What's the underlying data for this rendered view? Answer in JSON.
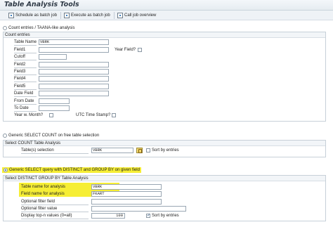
{
  "window": {
    "title": "Table Analysis Tools"
  },
  "toolbar": {
    "buttons": [
      {
        "label": "Schedule as batch job",
        "icon": "clock-icon"
      },
      {
        "label": "Execute as batch job",
        "icon": "execute-icon"
      },
      {
        "label": "Call job overview",
        "icon": "overview-icon"
      }
    ]
  },
  "sections": {
    "count_entries": {
      "radio_label": "Count entries / TAANA-like analysis",
      "group_title": "Count entries",
      "table_name": {
        "label": "Table Name",
        "value": "VBRK"
      },
      "field1": {
        "label": "Field1",
        "value": ""
      },
      "year_field": {
        "label": "Year Field?",
        "checked": false
      },
      "cutoff": {
        "label": "Cutoff",
        "value": ""
      },
      "field2": {
        "label": "Field2",
        "value": ""
      },
      "field3": {
        "label": "Field3",
        "value": ""
      },
      "field4": {
        "label": "Field4",
        "value": ""
      },
      "field5": {
        "label": "Field5",
        "value": ""
      },
      "date_field": {
        "label": "Date Field",
        "value": ""
      },
      "from_date": {
        "label": "From Date",
        "value": ""
      },
      "to_date": {
        "label": "To Date",
        "value": ""
      },
      "year_month": {
        "label": "Year w. Month?",
        "checked": false
      },
      "utc_stamp": {
        "label": "UTC Time Stamp?",
        "checked": false
      }
    },
    "generic_count": {
      "radio_label": "Generic SELECT COUNT on free table selection",
      "group_title": "Select COUNT Table Analysis",
      "table_selection": {
        "label": "Table(s) selection",
        "value": "VBRK"
      },
      "sort_by_entries": {
        "label": "Sort by entries",
        "checked": false
      }
    },
    "distinct_group": {
      "radio_label": "Generic SELECT query with DISTINCT and GROUP BY on given field",
      "selected": true,
      "group_title": "Select DISTINCT GROUP BY Table Analysis",
      "table_name": {
        "label": "Table name for analysis",
        "value": "VBRK"
      },
      "field_name": {
        "label": "Field name for analysis",
        "value": "FKART"
      },
      "optional_filter_field": {
        "label": "Optional filter field",
        "value": ""
      },
      "optional_filter_value": {
        "label": "Optional filter value",
        "value": ""
      },
      "display_top_n": {
        "label": "Display top-n values (0=all)",
        "value": "100"
      },
      "sort_by_entries": {
        "label": "Sort by entries",
        "checked": true
      }
    }
  },
  "colors": {
    "highlight": "#f6ee35",
    "frame": "#c7d0d8",
    "title_text": "#2f3a46"
  }
}
